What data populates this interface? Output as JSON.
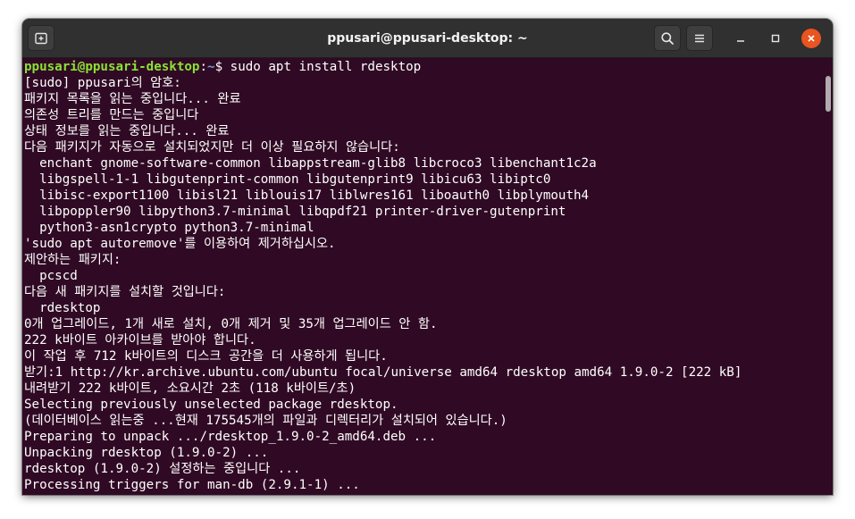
{
  "window": {
    "title": "ppusari@ppusari-desktop: ~"
  },
  "prompt": {
    "user_host": "ppusari@ppusari-desktop",
    "separator": ":",
    "path": "~",
    "symbol": "$ ",
    "command": "sudo apt install rdesktop"
  },
  "output_lines": [
    "[sudo] ppusari의 암호:",
    "패키지 목록을 읽는 중입니다... 완료",
    "의존성 트리를 만드는 중입니다",
    "상태 정보를 읽는 중입니다... 완료",
    "다음 패키지가 자동으로 설치되었지만 더 이상 필요하지 않습니다:",
    "  enchant gnome-software-common libappstream-glib8 libcroco3 libenchant1c2a",
    "  libgspell-1-1 libgutenprint-common libgutenprint9 libicu63 libiptc0",
    "  libisc-export1100 libisl21 liblouis17 liblwres161 liboauth0 libplymouth4",
    "  libpoppler90 libpython3.7-minimal libqpdf21 printer-driver-gutenprint",
    "  python3-asn1crypto python3.7-minimal",
    "'sudo apt autoremove'를 이용하여 제거하십시오.",
    "제안하는 패키지:",
    "  pcscd",
    "다음 새 패키지를 설치할 것입니다:",
    "  rdesktop",
    "0개 업그레이드, 1개 새로 설치, 0개 제거 및 35개 업그레이드 안 함.",
    "222 k바이트 아카이브를 받아야 합니다.",
    "이 작업 후 712 k바이트의 디스크 공간을 더 사용하게 됩니다.",
    "받기:1 http://kr.archive.ubuntu.com/ubuntu focal/universe amd64 rdesktop amd64 1.9.0-2 [222 kB]",
    "내려받기 222 k바이트, 소요시간 2초 (118 k바이트/초)",
    "Selecting previously unselected package rdesktop.",
    "(데이터베이스 읽는중 ...현재 175545개의 파일과 디렉터리가 설치되어 있습니다.)",
    "Preparing to unpack .../rdesktop_1.9.0-2_amd64.deb ...",
    "Unpacking rdesktop (1.9.0-2) ...",
    "rdesktop (1.9.0-2) 설정하는 중입니다 ...",
    "Processing triggers for man-db (2.9.1-1) ..."
  ],
  "icons": {
    "new_tab": "new-tab-icon",
    "search": "search-icon",
    "menu": "hamburger-menu-icon",
    "minimize": "minimize-icon",
    "maximize": "maximize-icon",
    "close": "close-icon"
  },
  "colors": {
    "terminal_bg": "#300a24",
    "titlebar_bg": "#303030",
    "prompt_user": "#8ae234",
    "prompt_path": "#729fcf",
    "close_button": "#e95420"
  }
}
